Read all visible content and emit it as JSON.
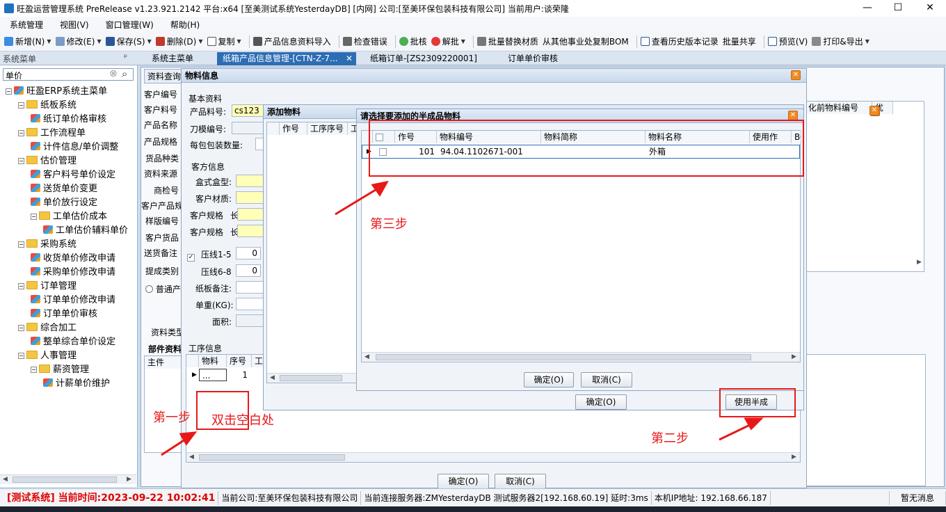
{
  "window": {
    "title": "旺盈运营管理系统 PreRelease v1.23.921.2142 平台:x64 [至美测试系统YesterdayDB] [内网] 公司:[至美环保包装科技有限公司] 当前用户:谈荣隆"
  },
  "menu": [
    "系统管理",
    "视图(V)",
    "窗口管理(W)",
    "帮助(H)"
  ],
  "toolbar": {
    "new": "新增(N)",
    "edit": "修改(E)",
    "save": "保存(S)",
    "delete": "删除(D)",
    "copy": "复制",
    "import": "产品信息资料导入",
    "check_error": "检查错误",
    "approve": "批核",
    "unapprove": "解批",
    "batch_replace": "批量替换材质",
    "copy_bom": "从其他事业处复制BOM",
    "history": "查看历史版本记录",
    "batch_share": "批量共享",
    "preview": "预览(V)",
    "print_export": "打印&导出"
  },
  "sidebar": {
    "header": "系统菜单",
    "pin": "ᵖ",
    "search_value": "单价",
    "tree": [
      {
        "label": "旺盈ERP系统主菜单",
        "level": 0,
        "kind": "root"
      },
      {
        "label": "纸板系统",
        "level": 1,
        "kind": "folder"
      },
      {
        "label": "纸订单价格审核",
        "level": 2,
        "kind": "leaf"
      },
      {
        "label": "工作流程单",
        "level": 1,
        "kind": "folder"
      },
      {
        "label": "计件信息/单价调整",
        "level": 2,
        "kind": "leaf"
      },
      {
        "label": "估价管理",
        "level": 1,
        "kind": "folder"
      },
      {
        "label": "客户料号单价设定",
        "level": 2,
        "kind": "leaf"
      },
      {
        "label": "送货单价变更",
        "level": 2,
        "kind": "leaf"
      },
      {
        "label": "单价放行设定",
        "level": 2,
        "kind": "leaf"
      },
      {
        "label": "工单估价成本",
        "level": 2,
        "kind": "folder"
      },
      {
        "label": "工单估价辅料单价",
        "level": 3,
        "kind": "leaf"
      },
      {
        "label": "采购系统",
        "level": 1,
        "kind": "folder"
      },
      {
        "label": "收货单价修改申请",
        "level": 2,
        "kind": "leaf"
      },
      {
        "label": "采购单价修改申请",
        "level": 2,
        "kind": "leaf"
      },
      {
        "label": "订单管理",
        "level": 1,
        "kind": "folder"
      },
      {
        "label": "订单单价修改申请",
        "level": 2,
        "kind": "leaf"
      },
      {
        "label": "订单单价审核",
        "level": 2,
        "kind": "leaf"
      },
      {
        "label": "综合加工",
        "level": 1,
        "kind": "folder"
      },
      {
        "label": "整单综合单价设定",
        "level": 2,
        "kind": "leaf"
      },
      {
        "label": "人事管理",
        "level": 1,
        "kind": "folder"
      },
      {
        "label": "薪资管理",
        "level": 2,
        "kind": "folder"
      },
      {
        "label": "计薪单价维护",
        "level": 3,
        "kind": "leaf"
      }
    ]
  },
  "tabs": [
    "系统主菜单",
    "纸箱产品信息管理-[CTN-Z-7...",
    "纸箱订单-[ZS2309220001]",
    "订单单价审核"
  ],
  "tab_close": "✕",
  "bg_panel": {
    "query_tab": "资料查询",
    "labels": [
      "客户编号",
      "客户料号",
      "产品名称",
      "产品规格",
      "货品种类",
      "资料来源",
      "商检号",
      "客户产品规",
      "样版编号",
      "客户货品",
      "送货备注",
      "提成类别"
    ],
    "radio": "普通产",
    "data_type": "资料类型",
    "parts_section": "部件资料",
    "main_col": "主件"
  },
  "material_info": {
    "title": "物料信息",
    "basic": "基本资料",
    "product_code_label": "产品料号:",
    "product_code": "cs123",
    "die_label": "刀模编号:",
    "pack_label": "每包包装数量:",
    "customer_info": "客方信息",
    "box_type": "盒式盒型:",
    "cust_material": "客户材质:",
    "cust_spec1": "客户规格",
    "len1": "长",
    "cust_spec2": "客户规格",
    "len2": "长",
    "crease15": "压线1-5",
    "crease15_val": "0",
    "crease68": "压线6-8",
    "crease68_val": "0",
    "board_note": "纸板备注:",
    "weight": "单重(KG):",
    "area": "面积:",
    "process_info": "工序信息",
    "proc_cols": [
      "物料",
      "序号",
      "工"
    ],
    "proc_row": [
      "...",
      "1"
    ],
    "ok": "确定(O)",
    "cancel": "取消(C)"
  },
  "add_material": {
    "title": "添加物料",
    "cols": [
      "作号",
      "工序序号",
      "工"
    ],
    "ok": "确定(O)",
    "use_semi": "使用半成"
  },
  "semi_dialog": {
    "title": "请选择要添加的半成品物料",
    "cols": [
      "作号",
      "物料编号",
      "物料简称",
      "物料名称",
      "使用作",
      "BO"
    ],
    "row": {
      "no": "101",
      "code": "94.04.1102671-001",
      "short": "",
      "name": "外箱"
    },
    "ok": "确定(O)",
    "cancel": "取消(C)"
  },
  "right_grid": {
    "cols": [
      "化前物料编号",
      "优"
    ]
  },
  "annotations": {
    "step1": "第一步",
    "step1_hint": "双击空白处",
    "step2": "第二步",
    "step3": "第三步"
  },
  "statusbar": {
    "test": "[测试系统] 当前时间:2023-09-22 10:02:41",
    "company": "当前公司:至美环保包装科技有限公司",
    "server": "当前连接服务器:ZMYesterdayDB 测试服务器2[192.168.60.19] 延时:3ms",
    "ip": "本机IP地址: 192.168.66.187",
    "msg": "暂无消息"
  },
  "colors": {
    "annotation_red": "#e81818",
    "test_status_red": "#e00000",
    "yellow_input": "#ffffb8",
    "dialog_title_bg": "#c8d8ec"
  },
  "icons": {
    "close": "✕",
    "maximize": "☐",
    "minimize": "—",
    "search": "⌕",
    "clear": "⊗"
  }
}
